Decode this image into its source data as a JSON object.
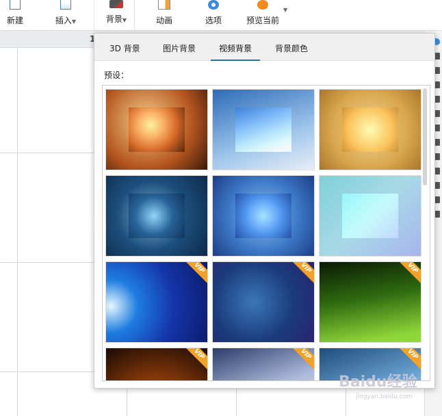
{
  "toolbar": {
    "items": [
      {
        "label": "新建"
      },
      {
        "label": "插入"
      },
      {
        "label": "背景"
      },
      {
        "label": "动画"
      },
      {
        "label": "选项"
      },
      {
        "label": "预览当前"
      }
    ]
  },
  "ruler": {
    "marker": "1"
  },
  "popup": {
    "tabs": [
      {
        "label": "3D 背景"
      },
      {
        "label": "图片背景"
      },
      {
        "label": "视频背景"
      },
      {
        "label": "背景颜色"
      }
    ],
    "active_tab": "视频背景",
    "preset_label": "预设：",
    "vip_label": "VIP",
    "thumbnails": [
      {
        "name": "autumn-leaves",
        "bg": "radial-gradient(circle at 40% 40%,#f6d08a,#b3541e 60%,#3a1a0a)",
        "vip": false
      },
      {
        "name": "blue-sky",
        "bg": "linear-gradient(160deg,#2d6bb8,#9cc4ea 60%,#e8eef6)",
        "vip": false
      },
      {
        "name": "golden-droplets",
        "bg": "radial-gradient(circle,#f1d79a,#d9a64d 60%,#a9772a)",
        "vip": false
      },
      {
        "name": "earth-globe",
        "bg": "radial-gradient(circle at 45% 50%,#7cb6d6,#1d4f7d 50%,#0d2a4a)",
        "vip": false
      },
      {
        "name": "snowflakes",
        "bg": "radial-gradient(circle,#8fc2f0,#3d78c6 55%,#1d3e86)",
        "vip": false
      },
      {
        "name": "spring-bokeh",
        "bg": "linear-gradient(135deg,#7fd0d8,#a8d9e6 50%,#a8b4ee)",
        "vip": false
      },
      {
        "name": "blue-tech-light",
        "bg": "radial-gradient(circle at 5% 55%,#e6f6ff,#1e7de0 25%,#1434a8 60%,#0c1b6a)",
        "vip": true
      },
      {
        "name": "space-earth",
        "bg": "radial-gradient(circle at 40% 50%,#3b77b8,#1a3b7c 55%,#2a2470)",
        "vip": true
      },
      {
        "name": "green-aurora",
        "bg": "linear-gradient(170deg,#0a1a05,#2f6b10 45%,#8fd83a 90%)",
        "vip": true
      },
      {
        "name": "orange-rings",
        "bg": "radial-gradient(circle at 50% 90%,#f4a530,#8a3a0a 45%,#1a0a04)",
        "vip": true
      },
      {
        "name": "blue-white-glow",
        "bg": "linear-gradient(160deg,#2a3c6a,#a9b8d8 50%,#ffffff)",
        "vip": true
      },
      {
        "name": "blue-waves",
        "bg": "linear-gradient(160deg,#1f4d7a,#6fa8d8 55%,#cfe4f6)",
        "vip": true
      }
    ]
  },
  "watermark": {
    "text": "Baidu经验",
    "sub": "jingyan.baidu.com"
  }
}
